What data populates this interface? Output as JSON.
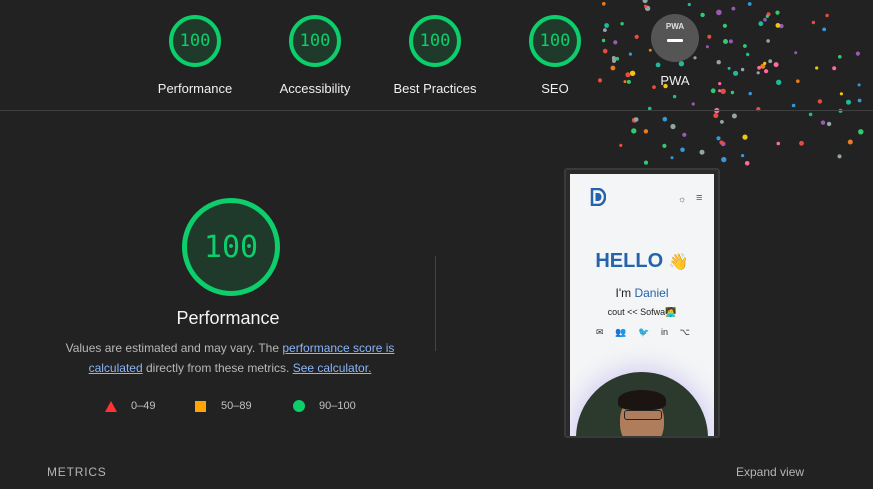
{
  "colors": {
    "pass": "#0cce6b",
    "average": "#ffa400",
    "fail": "#ff3333",
    "link": "#8ab4f8",
    "background": "#222222"
  },
  "gauges": [
    {
      "score": "100",
      "label": "Performance"
    },
    {
      "score": "100",
      "label": "Accessibility"
    },
    {
      "score": "100",
      "label": "Best Practices"
    },
    {
      "score": "100",
      "label": "SEO"
    }
  ],
  "pwa": {
    "badge_text": "PWA",
    "label": "PWA",
    "icon": "pwa-badge-icon"
  },
  "main": {
    "score": "100",
    "title": "Performance",
    "desc_prefix": "Values are estimated and may vary. The ",
    "score_link": "performance score is calculated",
    "desc_mid": " directly from these metrics. ",
    "calc_link": "See calculator."
  },
  "legend": {
    "fail": "0–49",
    "average": "50–89",
    "pass": "90–100"
  },
  "screenshot": {
    "hello": "HELLO",
    "wave": "👋",
    "intro_prefix": "I'm ",
    "name": "Daniel",
    "code": "cout << Sofwa🧑‍💻",
    "socials": [
      "✉",
      "👥",
      "🐦",
      "in",
      "⌥"
    ]
  },
  "footer": {
    "metrics": "METRICS",
    "expand": "Expand view"
  }
}
